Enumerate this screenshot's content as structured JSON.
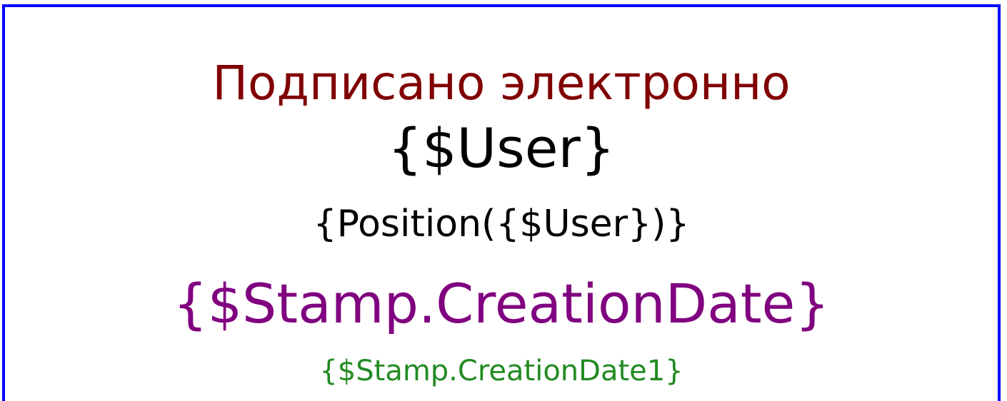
{
  "stamp": {
    "title": "Подписано электронно",
    "user": "{$User}",
    "position": "{Position({$User})}",
    "creation_date": "{$Stamp.CreationDate}",
    "creation_date1": "{$Stamp.CreationDate1}"
  },
  "colors": {
    "border": "#0000ff",
    "title": "#800000",
    "user": "#000000",
    "position": "#000000",
    "creation_date": "#800080",
    "creation_date1": "#228b22"
  }
}
